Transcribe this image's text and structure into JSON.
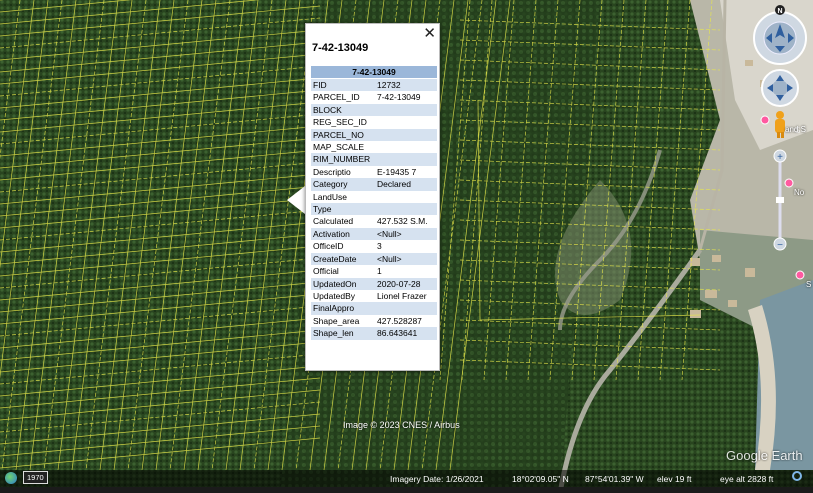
{
  "popup": {
    "title": "7-42-13049",
    "header": "7-42-13049",
    "close_label": "✕",
    "rows": [
      {
        "key": "FID",
        "value": "12732"
      },
      {
        "key": "PARCEL_ID",
        "value": "7-42-13049"
      },
      {
        "key": "BLOCK",
        "value": ""
      },
      {
        "key": "REG_SEC_ID",
        "value": ""
      },
      {
        "key": "PARCEL_NO",
        "value": ""
      },
      {
        "key": "MAP_SCALE",
        "value": ""
      },
      {
        "key": "RIM_NUMBER",
        "value": ""
      },
      {
        "key": "Descriptio",
        "value": "E-19435 7"
      },
      {
        "key": "Category",
        "value": "Declared"
      },
      {
        "key": "LandUse",
        "value": ""
      },
      {
        "key": "Type",
        "value": ""
      },
      {
        "key": "Calculated",
        "value": "427.532 S.M."
      },
      {
        "key": "Activation",
        "value": "<Null>"
      },
      {
        "key": "OfficeID",
        "value": "3"
      },
      {
        "key": "CreateDate",
        "value": "<Null>"
      },
      {
        "key": "Official",
        "value": "1"
      },
      {
        "key": "UpdatedOn",
        "value": "2020-07-28"
      },
      {
        "key": "UpdatedBy",
        "value": "Lionel Frazer"
      },
      {
        "key": "FinalAppro",
        "value": ""
      },
      {
        "key": "Shape_area",
        "value": "427.528287"
      },
      {
        "key": "Shape_len",
        "value": "86.643641"
      }
    ]
  },
  "map": {
    "credit": "Image © 2023 CNES / Airbus",
    "logo": "Google Earth",
    "compass_label": "N",
    "place_labels": [
      "S",
      "and S",
      "No",
      "S"
    ],
    "colors": {
      "parcel_lines": "#e8e84a",
      "vegetation": "#2c4a22",
      "water": "#6f8f9a",
      "sand": "#c9c3b5"
    }
  },
  "status": {
    "year": "1970",
    "imagery_date": "Imagery Date: 1/26/2021",
    "lat": "18°02'09.05\" N",
    "lon": "87°54'01.39\" W",
    "elev": "elev   19 ft",
    "eye_alt": "eye alt  2828 ft"
  },
  "icons": [
    "compass-icon",
    "look-joystick-icon",
    "move-joystick-icon",
    "pegman-icon",
    "zoom-in-icon",
    "zoom-out-icon",
    "placemark-icon",
    "globe-icon",
    "historical-imagery-icon"
  ]
}
